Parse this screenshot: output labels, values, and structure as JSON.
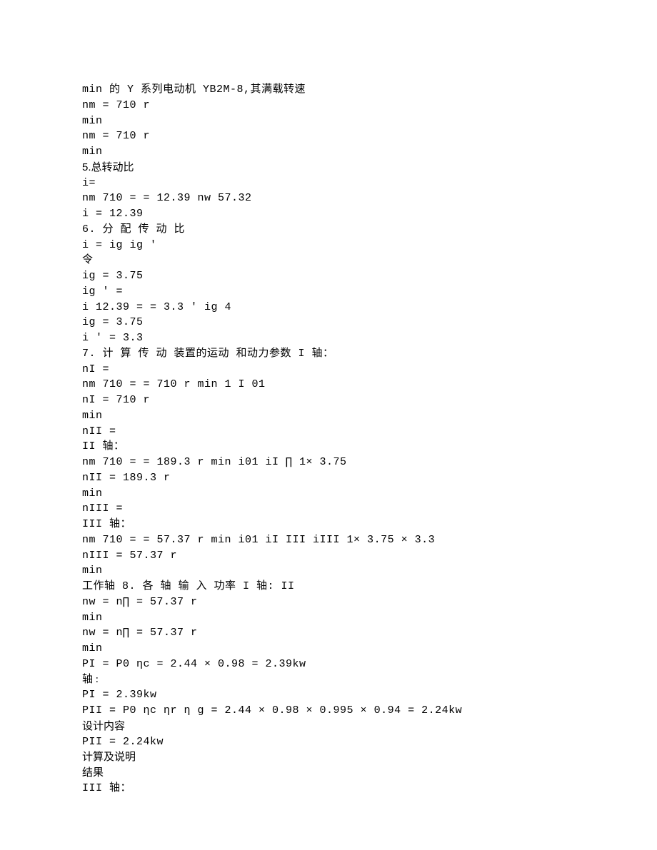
{
  "lines": [
    {
      "cls": "mono",
      "text": "min 的 Y 系列电动机 YB2M-8,其满载转速"
    },
    {
      "cls": "mono",
      "text": "nm = 710 r"
    },
    {
      "cls": "mono",
      "text": "min"
    },
    {
      "cls": "mono",
      "text": "nm = 710 r"
    },
    {
      "cls": "mono",
      "text": "min"
    },
    {
      "cls": "sans",
      "text": "5.总转动比"
    },
    {
      "cls": "mono",
      "text": "i="
    },
    {
      "cls": "mono",
      "text": "nm 710 = = 12.39 nw 57.32"
    },
    {
      "cls": "mono",
      "text": "i = 12.39"
    },
    {
      "cls": "mono",
      "text": "6. 分 配 传 动 比"
    },
    {
      "cls": "mono",
      "text": "i = ig ig '"
    },
    {
      "cls": "cjk",
      "text": "令"
    },
    {
      "cls": "mono",
      "text": "ig = 3.75"
    },
    {
      "cls": "mono",
      "text": "ig ' ="
    },
    {
      "cls": "mono",
      "text": "i 12.39 = = 3.3 ' ig 4"
    },
    {
      "cls": "mono",
      "text": "ig = 3.75"
    },
    {
      "cls": "mono",
      "text": "i ' = 3.3"
    },
    {
      "cls": "mono",
      "text": "7. 计 算 传 动 装置的运动 和动力参数 I 轴："
    },
    {
      "cls": "mono",
      "text": "nI ="
    },
    {
      "cls": "mono",
      "text": "nm 710 = = 710 r min 1 I 01"
    },
    {
      "cls": "mono",
      "text": "nI = 710 r"
    },
    {
      "cls": "mono",
      "text": "min"
    },
    {
      "cls": "mono",
      "text": "nII ="
    },
    {
      "cls": "mono",
      "text": "II 轴："
    },
    {
      "cls": "mono",
      "text": "nm 710 = = 189.3 r min i01 iI ∏ 1× 3.75"
    },
    {
      "cls": "mono",
      "text": "nII = 189.3 r"
    },
    {
      "cls": "mono",
      "text": "min"
    },
    {
      "cls": "mono",
      "text": "nIII ="
    },
    {
      "cls": "mono",
      "text": "III 轴："
    },
    {
      "cls": "mono",
      "text": "nm 710 = = 57.37 r min i01 iI III iIII 1× 3.75 × 3.3"
    },
    {
      "cls": "mono",
      "text": "nIII = 57.37 r"
    },
    {
      "cls": "mono",
      "text": "min"
    },
    {
      "cls": "mono",
      "text": "工作轴 8. 各 轴 输 入 功率 I 轴: II"
    },
    {
      "cls": "mono",
      "text": "nw = n∏ = 57.37 r"
    },
    {
      "cls": "mono",
      "text": "min"
    },
    {
      "cls": "mono",
      "text": "nw = n∏ = 57.37 r"
    },
    {
      "cls": "mono",
      "text": "min"
    },
    {
      "cls": "mono",
      "text": "PI = P0 ηc = 2.44 × 0.98 = 2.39kw"
    },
    {
      "cls": "cjk",
      "text": "轴 :"
    },
    {
      "cls": "mono",
      "text": "PI = 2.39kw"
    },
    {
      "cls": "mono",
      "text": "PII = P0 ηc ηr η g = 2.44 × 0.98 × 0.995 × 0.94 = 2.24kw"
    },
    {
      "cls": "sans",
      "text": "设计内容"
    },
    {
      "cls": "mono",
      "text": "PII = 2.24kw"
    },
    {
      "cls": "sans",
      "text": "计算及说明"
    },
    {
      "cls": "sans",
      "text": "结果"
    },
    {
      "cls": "mono",
      "text": "III 轴："
    }
  ]
}
